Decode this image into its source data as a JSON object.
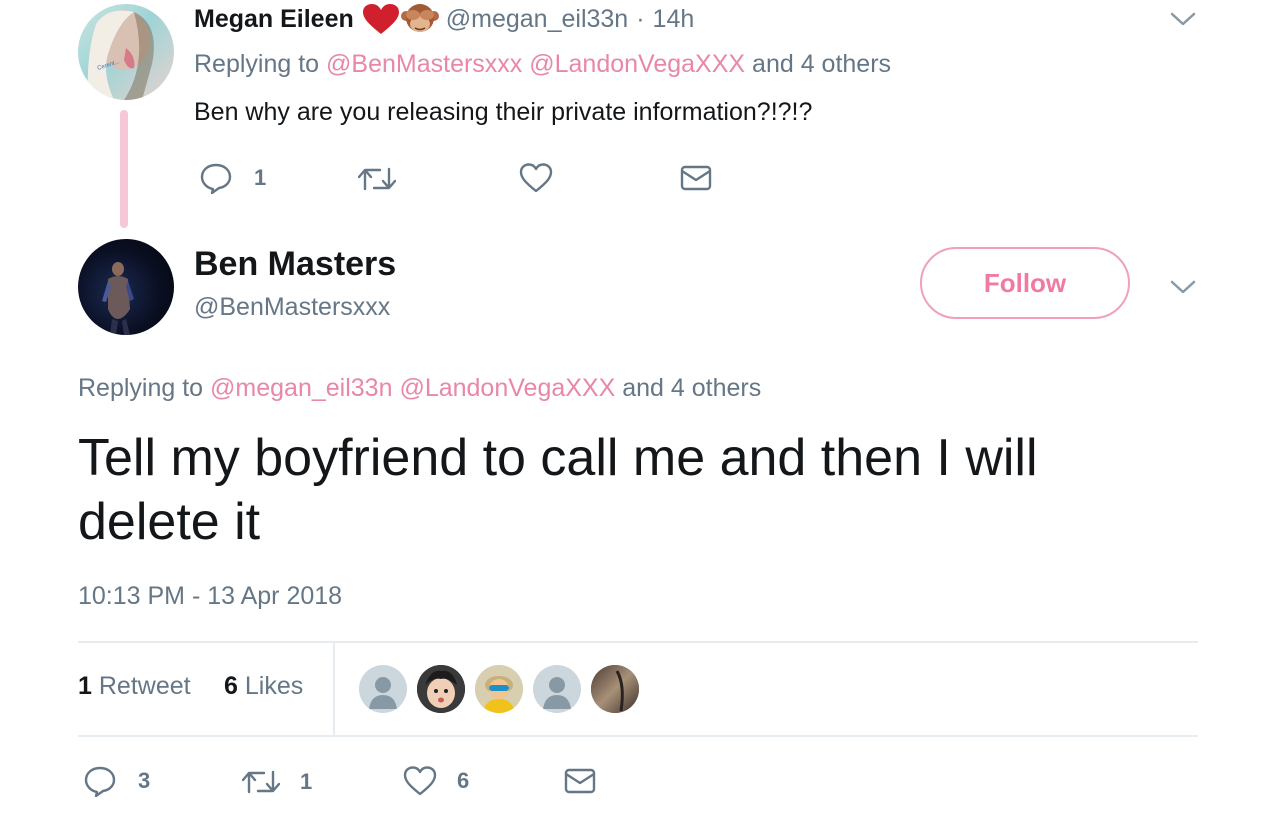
{
  "parent_tweet": {
    "name": "Megan Eileen",
    "emoji_icons": [
      "red-heart-icon",
      "see-no-evil-monkey-icon"
    ],
    "handle": "@megan_eil33n",
    "separator": "·",
    "time": "14h",
    "replying_prefix": "Replying to",
    "replying_mentions": [
      "@BenMastersxxx",
      "@LandonVegaXXX"
    ],
    "replying_suffix": "and 4 others",
    "text": "Ben why are you releasing their private information?!?!?",
    "actions": {
      "reply_count": "1",
      "retweet_count": "",
      "like_count": ""
    }
  },
  "main_tweet": {
    "name": "Ben Masters",
    "handle": "@BenMastersxxx",
    "follow_label": "Follow",
    "replying_prefix": "Replying to",
    "replying_mentions": [
      "@megan_eil33n",
      "@LandonVegaXXX"
    ],
    "replying_suffix": "and 4 others",
    "text_line1": "Tell my boyfriend to call me and then I will",
    "text_line2": "delete it",
    "timestamp": "10:13 PM - 13 Apr 2018",
    "stats": {
      "retweets_count": "1",
      "retweets_label": "Retweet",
      "likes_count": "6",
      "likes_label": "Likes"
    },
    "likers": [
      "default-avatar",
      "child-photo-avatar",
      "cartoon-avatar",
      "default-avatar",
      "photo-avatar"
    ],
    "actions": {
      "reply_count": "3",
      "retweet_count": "1",
      "like_count": "6"
    }
  },
  "colors": {
    "accent_pink": "#e887a8",
    "thread_line": "#f6c7d6",
    "muted": "#657786",
    "text": "#14171a",
    "divider": "#e6ecf0"
  }
}
